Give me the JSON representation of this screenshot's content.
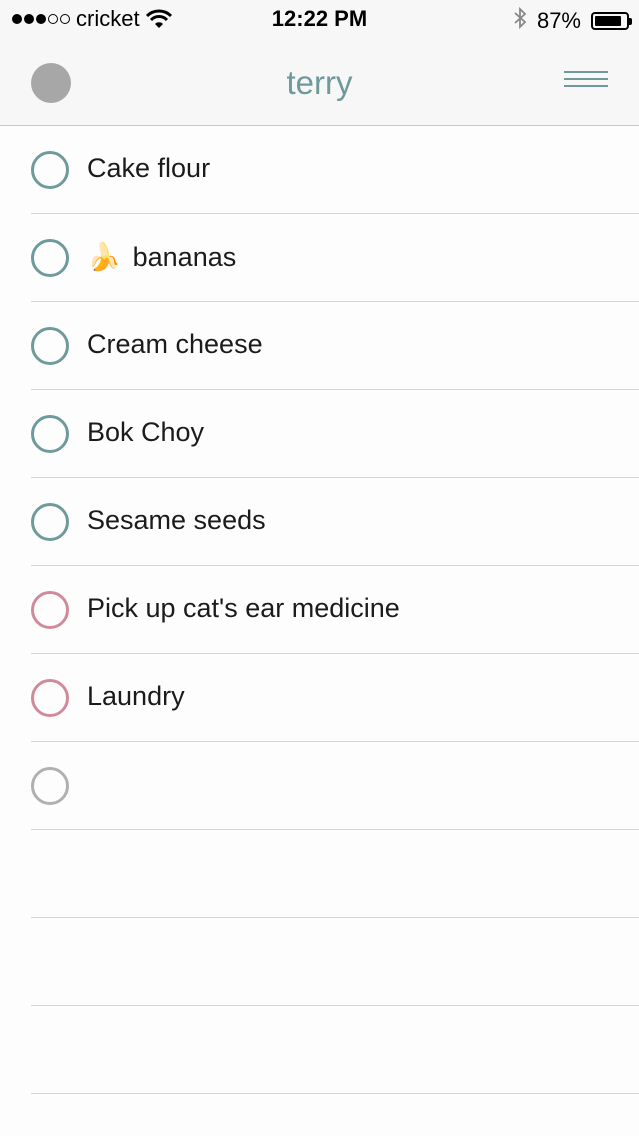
{
  "status_bar": {
    "carrier": "cricket",
    "time": "12:22 PM",
    "battery": "87%",
    "battery_level": 0.87,
    "signal_bars_filled": 3,
    "signal_bars_total": 5
  },
  "nav": {
    "title": "terry"
  },
  "colors": {
    "accent": "#6f9a9b",
    "priority": "#d28a9a",
    "empty": "#b0b0b0"
  },
  "items": [
    {
      "text": "Cake flour",
      "emoji": "",
      "color": "teal"
    },
    {
      "text": "bananas",
      "emoji": "🍌",
      "color": "teal"
    },
    {
      "text": "Cream cheese",
      "emoji": "",
      "color": "teal"
    },
    {
      "text": "Bok Choy",
      "emoji": "",
      "color": "teal"
    },
    {
      "text": "Sesame seeds",
      "emoji": "",
      "color": "teal"
    },
    {
      "text": "Pick up cat's ear medicine",
      "emoji": "",
      "color": "pink"
    },
    {
      "text": "Laundry",
      "emoji": "",
      "color": "pink"
    },
    {
      "text": "",
      "emoji": "",
      "color": "gray"
    }
  ]
}
